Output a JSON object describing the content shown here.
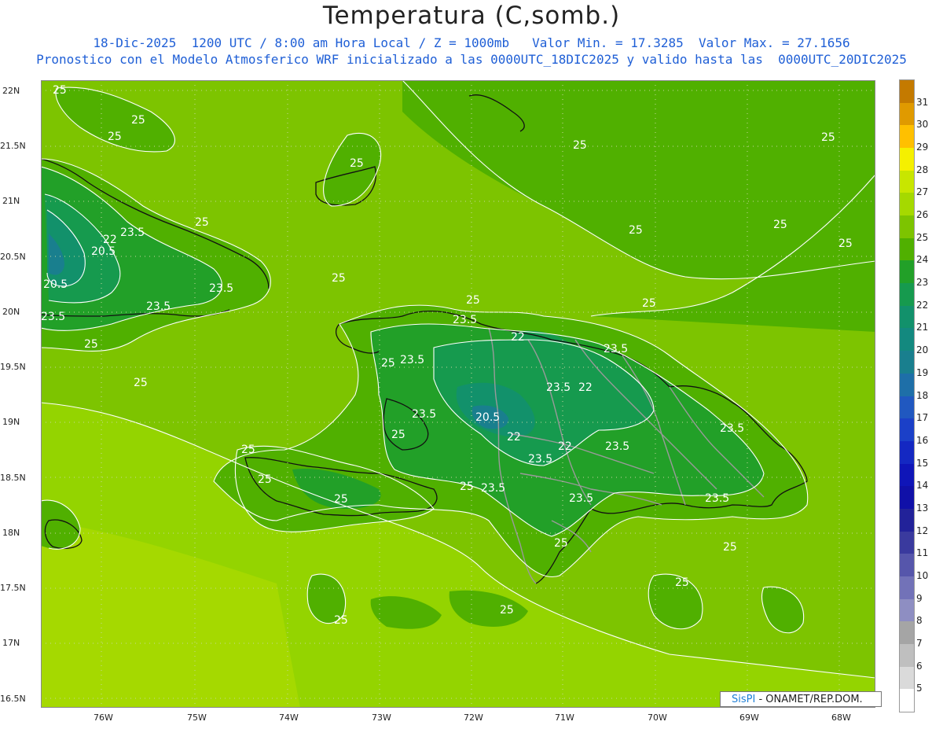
{
  "title": "Temperatura (C,somb.)",
  "subtitle_line1": "18-Dic-2025  1200 UTC / 8:00 am Hora Local / Z = 1000mb   Valor Min. = 17.3285  Valor Max. = 27.1656",
  "subtitle_line2": "Pronostico con el Modelo Atmosferico WRF inicializado a las 0000UTC_18DIC2025 y valido hasta las  0000UTC_20DIC2025",
  "credit": {
    "brand": "SisPI",
    "text": "- ONAMET/REP.DOM."
  },
  "axes": {
    "lat_labels": [
      "22N",
      "21.5N",
      "21N",
      "20.5N",
      "20N",
      "19.5N",
      "19N",
      "18.5N",
      "18N",
      "17.5N",
      "17N",
      "16.5N"
    ],
    "lon_labels": [
      "76W",
      "75W",
      "74W",
      "73W",
      "72W",
      "71W",
      "70W",
      "69W",
      "68W"
    ]
  },
  "colorbar": {
    "levels": [
      "31",
      "30",
      "29",
      "28",
      "27",
      "26",
      "25",
      "24",
      "23",
      "22",
      "21",
      "20",
      "19",
      "18",
      "17",
      "16",
      "15",
      "14",
      "13",
      "12",
      "11",
      "10",
      "9",
      "8",
      "7",
      "6",
      "5"
    ],
    "colors": [
      "#c47a00",
      "#e09a00",
      "#ffc000",
      "#f5f000",
      "#c8e600",
      "#a5d900",
      "#7dc400",
      "#50b000",
      "#22a028",
      "#169a4e",
      "#12916b",
      "#13897f",
      "#197f8e",
      "#1e6fa8",
      "#2058c0",
      "#1b40c8",
      "#1428c2",
      "#0f15b8",
      "#1010a8",
      "#222299",
      "#3a3a9e",
      "#5656ab",
      "#7272b8",
      "#8e8ec2",
      "#a5a5a5",
      "#bfbfbf",
      "#dadada",
      "#ffffff"
    ]
  },
  "map_data": {
    "variable": "Temperatura",
    "units": "C",
    "level": "1000mb",
    "valid": "18-Dic-2025 1200 UTC",
    "min": 17.3285,
    "max": 27.1656,
    "contour_labels": [
      "25",
      "23.5",
      "22",
      "20.5"
    ],
    "colors": {
      "sea_base": "#7dc400",
      "sea_south": "#94d400",
      "band_24": "#50b000",
      "band_23": "#22a028",
      "band_22": "#169a4e",
      "band_21": "#12916b",
      "band_20": "#197f8e"
    }
  }
}
